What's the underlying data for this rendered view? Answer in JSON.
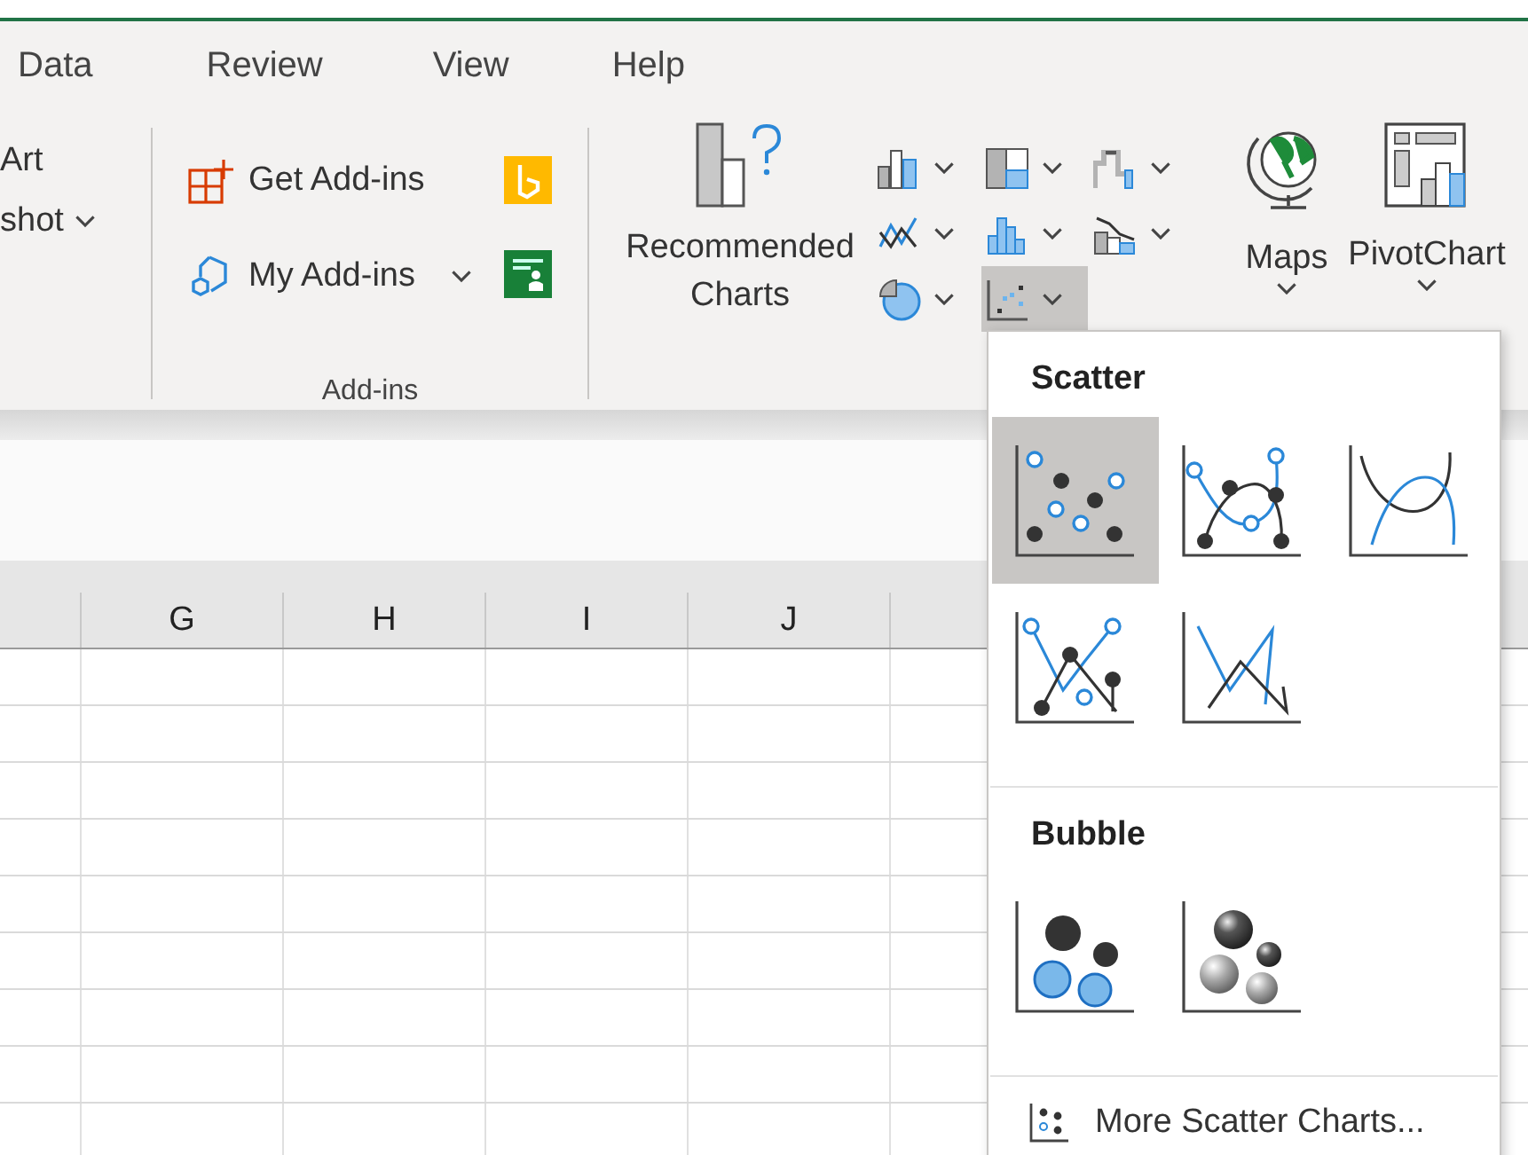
{
  "ribbon_tabs": [
    {
      "label": "Data"
    },
    {
      "label": "Review"
    },
    {
      "label": "View"
    },
    {
      "label": "Help"
    }
  ],
  "insert_group": {
    "items": [
      {
        "label": "Art",
        "has_menu": false
      },
      {
        "label": "shot",
        "has_menu": true
      }
    ]
  },
  "addins_group": {
    "label": "Add-ins",
    "buttons": [
      {
        "kind": "get",
        "label": "Get Add-ins",
        "has_menu": false
      },
      {
        "kind": "my",
        "label": "My Add-ins",
        "has_menu": true
      }
    ],
    "apps": [
      {
        "kind": "bing"
      },
      {
        "kind": "people"
      }
    ]
  },
  "charts_group": {
    "recommended": "Recommended Charts",
    "chart_types": [
      {
        "kind": "column",
        "selected": false
      },
      {
        "kind": "hierarchy",
        "selected": false
      },
      {
        "kind": "waterfall",
        "selected": false
      },
      {
        "kind": "line",
        "selected": false
      },
      {
        "kind": "statistic",
        "selected": false
      },
      {
        "kind": "combo",
        "selected": false
      },
      {
        "kind": "pie",
        "selected": false
      },
      {
        "kind": "scatter",
        "selected": true
      }
    ],
    "maps": "Maps",
    "pivot": "PivotChart"
  },
  "columns": [
    "G",
    "H",
    "I",
    "J"
  ],
  "scatter_menu": {
    "sections": [
      {
        "title": "Scatter",
        "options": [
          {
            "kind": "scatter",
            "selected": true
          },
          {
            "kind": "smooth-markers",
            "selected": false
          },
          {
            "kind": "smooth-lines",
            "selected": false
          },
          {
            "kind": "straight-markers",
            "selected": false
          },
          {
            "kind": "straight-lines",
            "selected": false
          }
        ]
      },
      {
        "title": "Bubble",
        "options": [
          {
            "kind": "bubble",
            "selected": false
          },
          {
            "kind": "bubble-3d",
            "selected": false
          }
        ]
      }
    ],
    "more": "More Scatter Charts..."
  }
}
